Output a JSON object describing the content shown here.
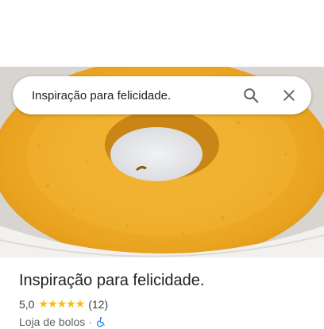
{
  "search": {
    "query": "Inspiração para felicidade.",
    "search_icon": "search-icon",
    "close_icon": "close-icon"
  },
  "hero": {
    "image": "cake-photo"
  },
  "place": {
    "title": "Inspiração para felicidade.",
    "rating": "5,0",
    "stars": "★★★★★",
    "star_color": "#fbbc04",
    "reviews": "(12)",
    "category": "Loja de bolos",
    "separator": "·",
    "accessibility_icon": "wheelchair-icon"
  }
}
